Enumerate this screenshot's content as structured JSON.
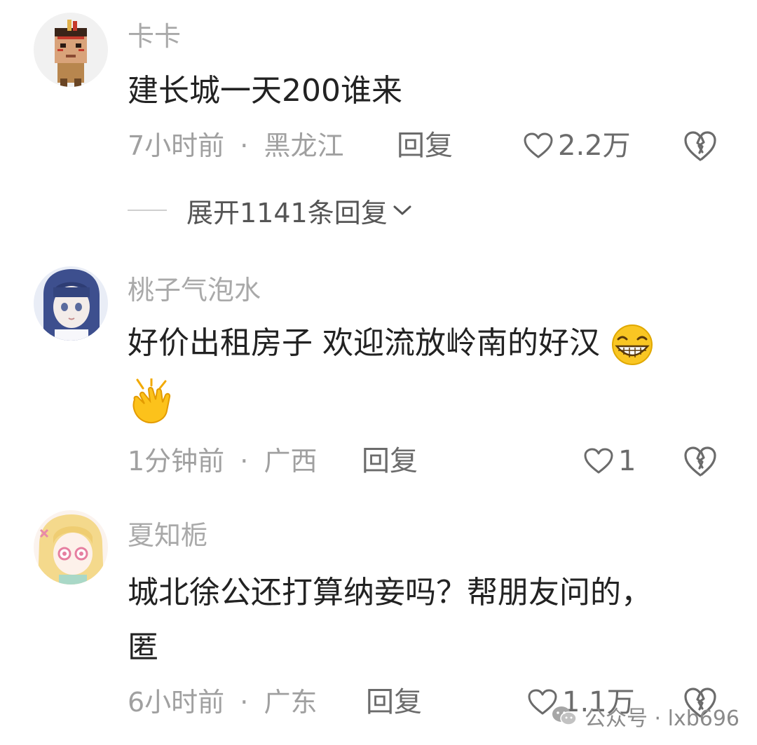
{
  "comments": [
    {
      "username": "卡卡",
      "text_lines": [
        "建长城一天200谁来"
      ],
      "time": "7小时前",
      "separator": "·",
      "location": "黑龙江",
      "reply_label": "回复",
      "likes": "2.2万",
      "expand_replies": "展开1141条回复"
    },
    {
      "username": "桃子气泡水",
      "text_lines": [
        "好价出租房子 欢迎流放岭南的好汉"
      ],
      "emojis": [
        "grinning-face-emoji",
        "clapping-hands-emoji"
      ],
      "time": "1分钟前",
      "separator": "·",
      "location": "广西",
      "reply_label": "回复",
      "likes": "1"
    },
    {
      "username": "夏知栀",
      "text_lines": [
        "城北徐公还打算纳妾吗？帮朋友问的，",
        "匿"
      ],
      "time": "6小时前",
      "separator": "·",
      "location": "广东",
      "reply_label": "回复",
      "likes": "1.1万"
    }
  ],
  "watermark": {
    "label": "公众号 · lxb696",
    "icon": "wechat-icon"
  },
  "colors": {
    "text": "#222222",
    "muted": "#a0a0a0",
    "action": "#6b6b6b"
  }
}
